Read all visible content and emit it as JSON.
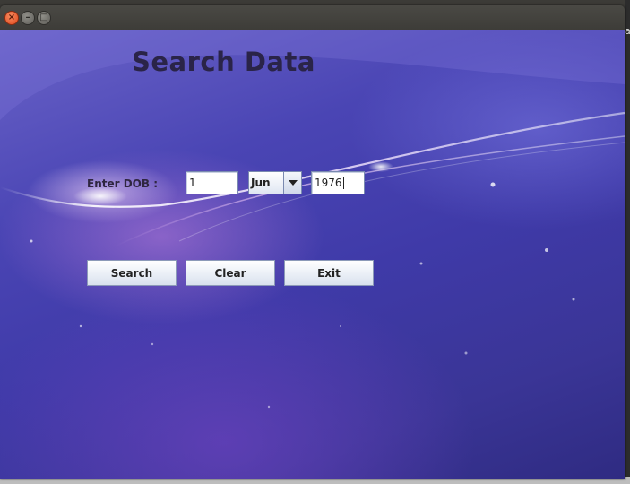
{
  "window": {
    "title": "",
    "controls": {
      "close_glyph": "×",
      "minimize_glyph": "–",
      "maximize_glyph": "□"
    }
  },
  "desktop": {
    "edge_fragment": "a"
  },
  "form": {
    "heading": "Search Data",
    "dob_label": "Enter DOB :",
    "day_value": "1",
    "month_selected": "Jun",
    "year_value": "1976"
  },
  "buttons": {
    "search_label": "Search",
    "clear_label": "Clear",
    "exit_label": "Exit"
  },
  "icons": {
    "close": "close-icon",
    "minimize": "minimize-icon",
    "maximize": "maximize-icon",
    "dropdown": "chevron-down-icon"
  },
  "colors": {
    "title_text": "#2a2448",
    "close_button": "#e0491d",
    "background_primary": "#4a45b4"
  }
}
